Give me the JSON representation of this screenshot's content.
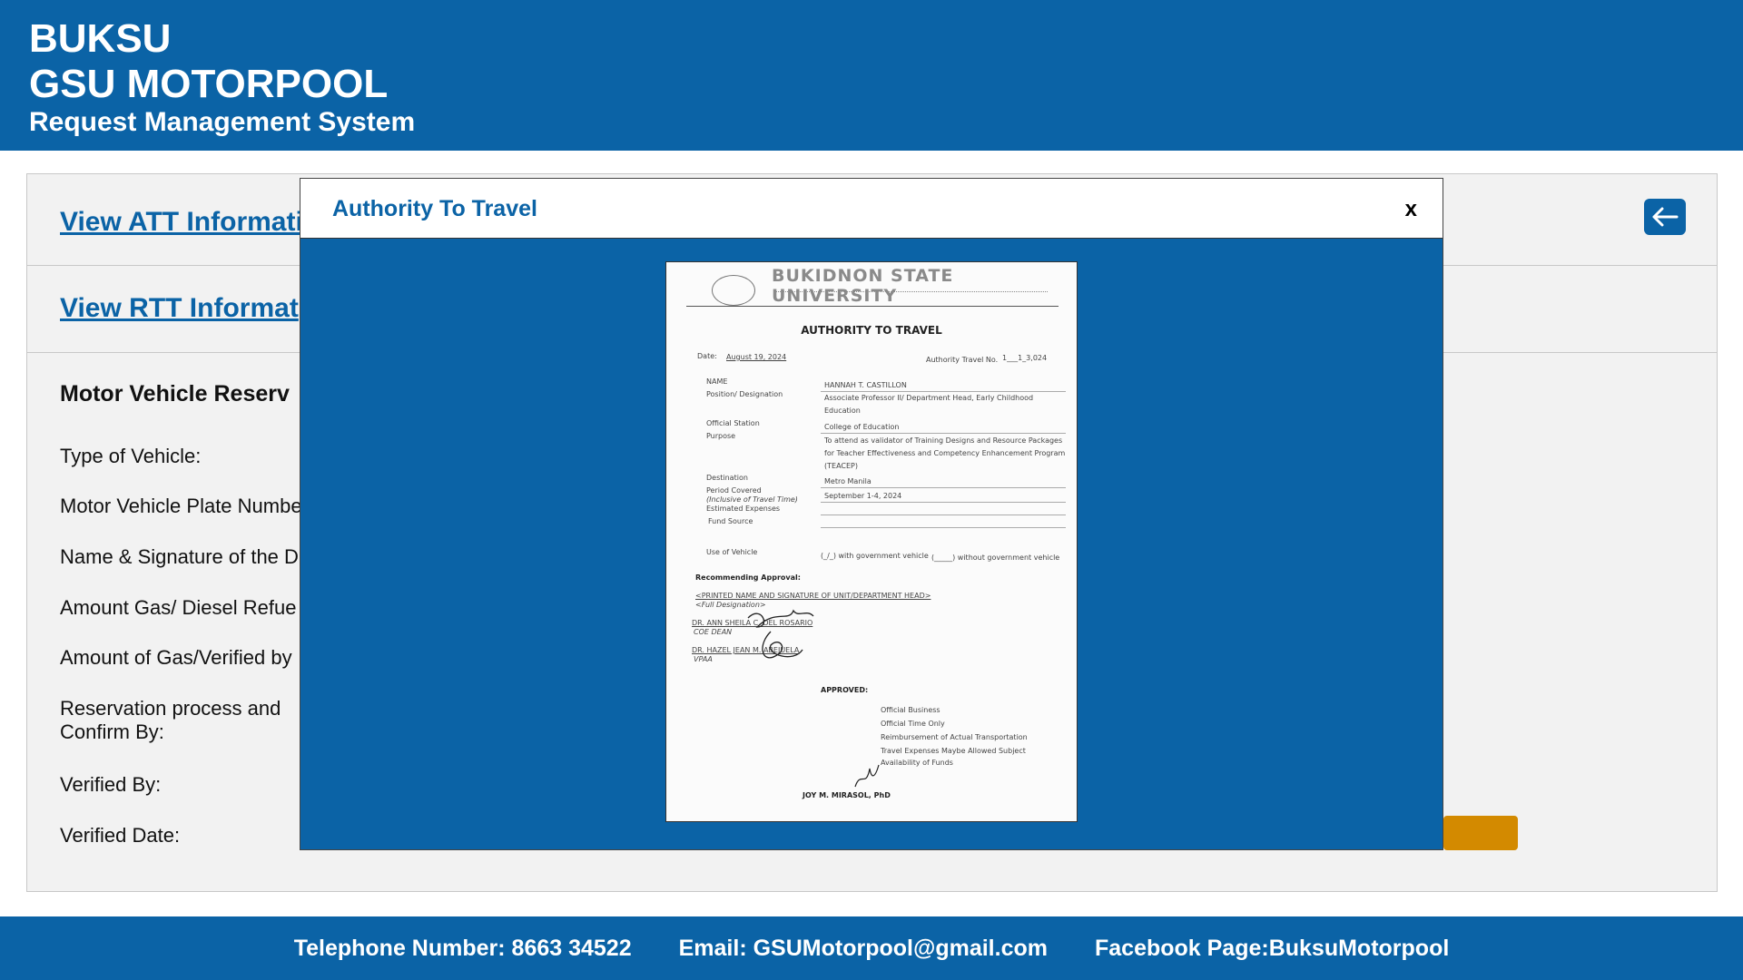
{
  "header": {
    "line1": "BUKSU",
    "line2": "GSU MOTORPOOL",
    "line3": "Request Management System"
  },
  "links": {
    "att": "View ATT Informati",
    "rtt": "View RTT Informat"
  },
  "section_title": "Motor Vehicle Reserv",
  "fields": {
    "type": "Type of Vehicle:",
    "plate": "Motor Vehicle Plate Numbe",
    "driver": "Name & Signature of the D",
    "refuel": "Amount Gas/ Diesel Refue",
    "verified_gas": "Amount of Gas/Verified by",
    "reservation_1": "Reservation process and",
    "reservation_2": "Confirm By:",
    "verified_by": "Verified By:",
    "verified_date": "Verified Date:"
  },
  "footer": {
    "phone": "Telephone Number: 8663 34522",
    "email": "Email: GSUMotorpool@gmail.com",
    "facebook": "Facebook Page:BuksuMotorpool"
  },
  "modal": {
    "title": "Authority To Travel",
    "close": "x"
  },
  "document": {
    "university": "BUKIDNON STATE UNIVERSITY",
    "heading": "AUTHORITY TO TRAVEL",
    "date_label": "Date:",
    "date_value": "August 19, 2024",
    "travel_no_label": "Authority Travel No.",
    "travel_no_value": "1___1_3,024",
    "name_label": "NAME",
    "name_value": "HANNAH T. CASTILLON",
    "position_label": "Position/ Designation",
    "position_value_1": "Associate   Professor   II/   Department   Head,   Early   Childhood",
    "position_value_2": "Education",
    "station_label": "Official Station",
    "station_value": "College of Education",
    "purpose_label": "Purpose",
    "purpose_value_1": "To attend as validator of Training Designs and Resource Packages",
    "purpose_value_2": "for Teacher Effectiveness and Competency Enhancement Program",
    "purpose_value_3": "(TEACEP)",
    "destination_label": "Destination",
    "destination_value": "Metro Manila",
    "period_label": "Period Covered",
    "period_sub": "(Inclusive of Travel Time)",
    "period_value": "September 1-4, 2024",
    "expenses_label": "Estimated Expenses",
    "fund_label": "Fund Source",
    "vehicle_label": "Use of Vehicle",
    "vehicle_with": "(_/_) with government vehicle",
    "vehicle_without": "(_____) without government vehicle",
    "recommending": "Recommending Approval:",
    "printed_name": "<PRINTED NAME AND SIGNATURE OF UNIT/DEPARTMENT HEAD>",
    "full_designation": "<Full Designation>",
    "dean_name": "DR. ANN SHEILA C. DEL ROSARIO",
    "dean_title": "COE DEAN",
    "vpaa_name": "DR. HAZEL JEAN M. ABEJUELA",
    "vpaa_title": "VPAA",
    "approved": "APPROVED:",
    "opt1": "Official Business",
    "opt2": "Official Time Only",
    "opt3": "Reimbursement of Actual Transportation",
    "opt4": "Travel Expenses Maybe Allowed Subject",
    "opt5": "Availability of Funds",
    "approver": "JOY M. MIRASOL, PhD"
  },
  "colors": {
    "primary": "#0b63a6",
    "accent": "#d38a00",
    "panel": "#f2f2f2"
  },
  "icons": {
    "back": "arrow-left-icon"
  }
}
